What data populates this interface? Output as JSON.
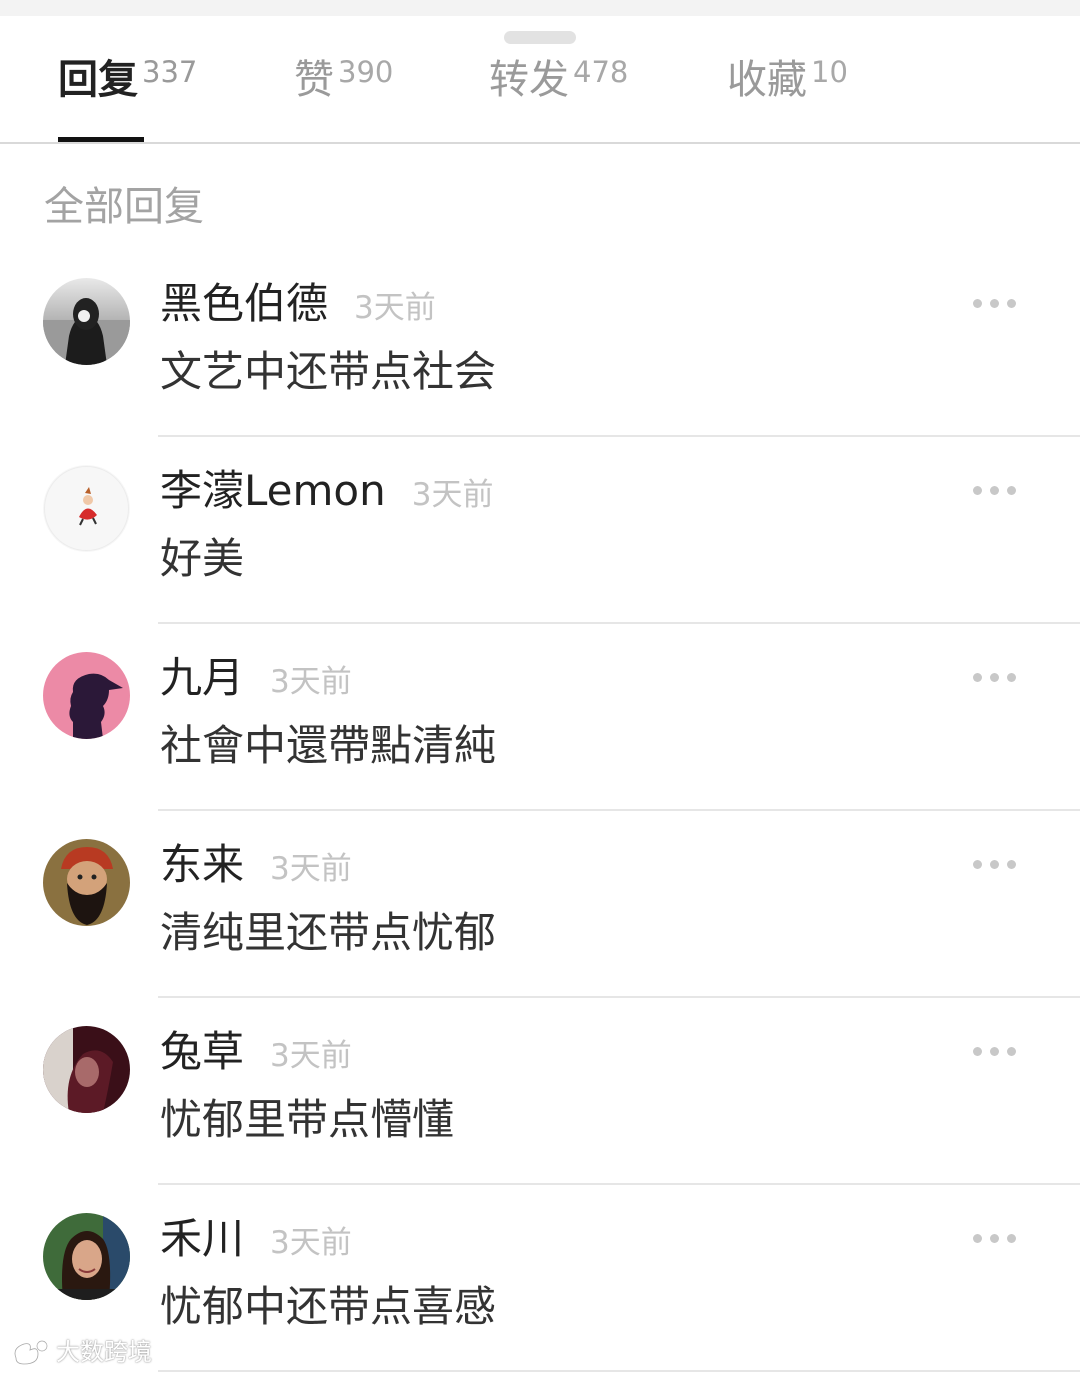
{
  "tabs": [
    {
      "label": "回复",
      "count": "337",
      "active": true
    },
    {
      "label": "赞",
      "count": "390",
      "active": false
    },
    {
      "label": "转发",
      "count": "478",
      "active": false
    },
    {
      "label": "收藏",
      "count": "10",
      "active": false
    }
  ],
  "section_title": "全部回复",
  "comments": [
    {
      "username": "黑色伯德",
      "time": "3天前",
      "text": "文艺中还带点社会",
      "avatar_icon": "hooded-figure-avatar"
    },
    {
      "username": "李濛Lemon",
      "time": "3天前",
      "text": "好美",
      "avatar_icon": "little-my-avatar"
    },
    {
      "username": "九月",
      "time": "3天前",
      "text": "社會中還帶點清純",
      "avatar_icon": "silhouette-profile-avatar"
    },
    {
      "username": "东来",
      "time": "3天前",
      "text": "清纯里还带点忧郁",
      "avatar_icon": "bearded-man-avatar"
    },
    {
      "username": "兔草",
      "time": "3天前",
      "text": "忧郁里带点懵懂",
      "avatar_icon": "dark-portrait-avatar"
    },
    {
      "username": "禾川",
      "time": "3天前",
      "text": "忧郁中还带点喜感",
      "avatar_icon": "woman-portrait-avatar"
    }
  ],
  "watermark": {
    "text": "大数跨境",
    "icon": "weibo-logo-icon"
  },
  "colors": {
    "active_tab": "#222222",
    "inactive_tab": "#9a9a9a",
    "time_text": "#c3c3c3",
    "divider": "#e6e6e6"
  }
}
